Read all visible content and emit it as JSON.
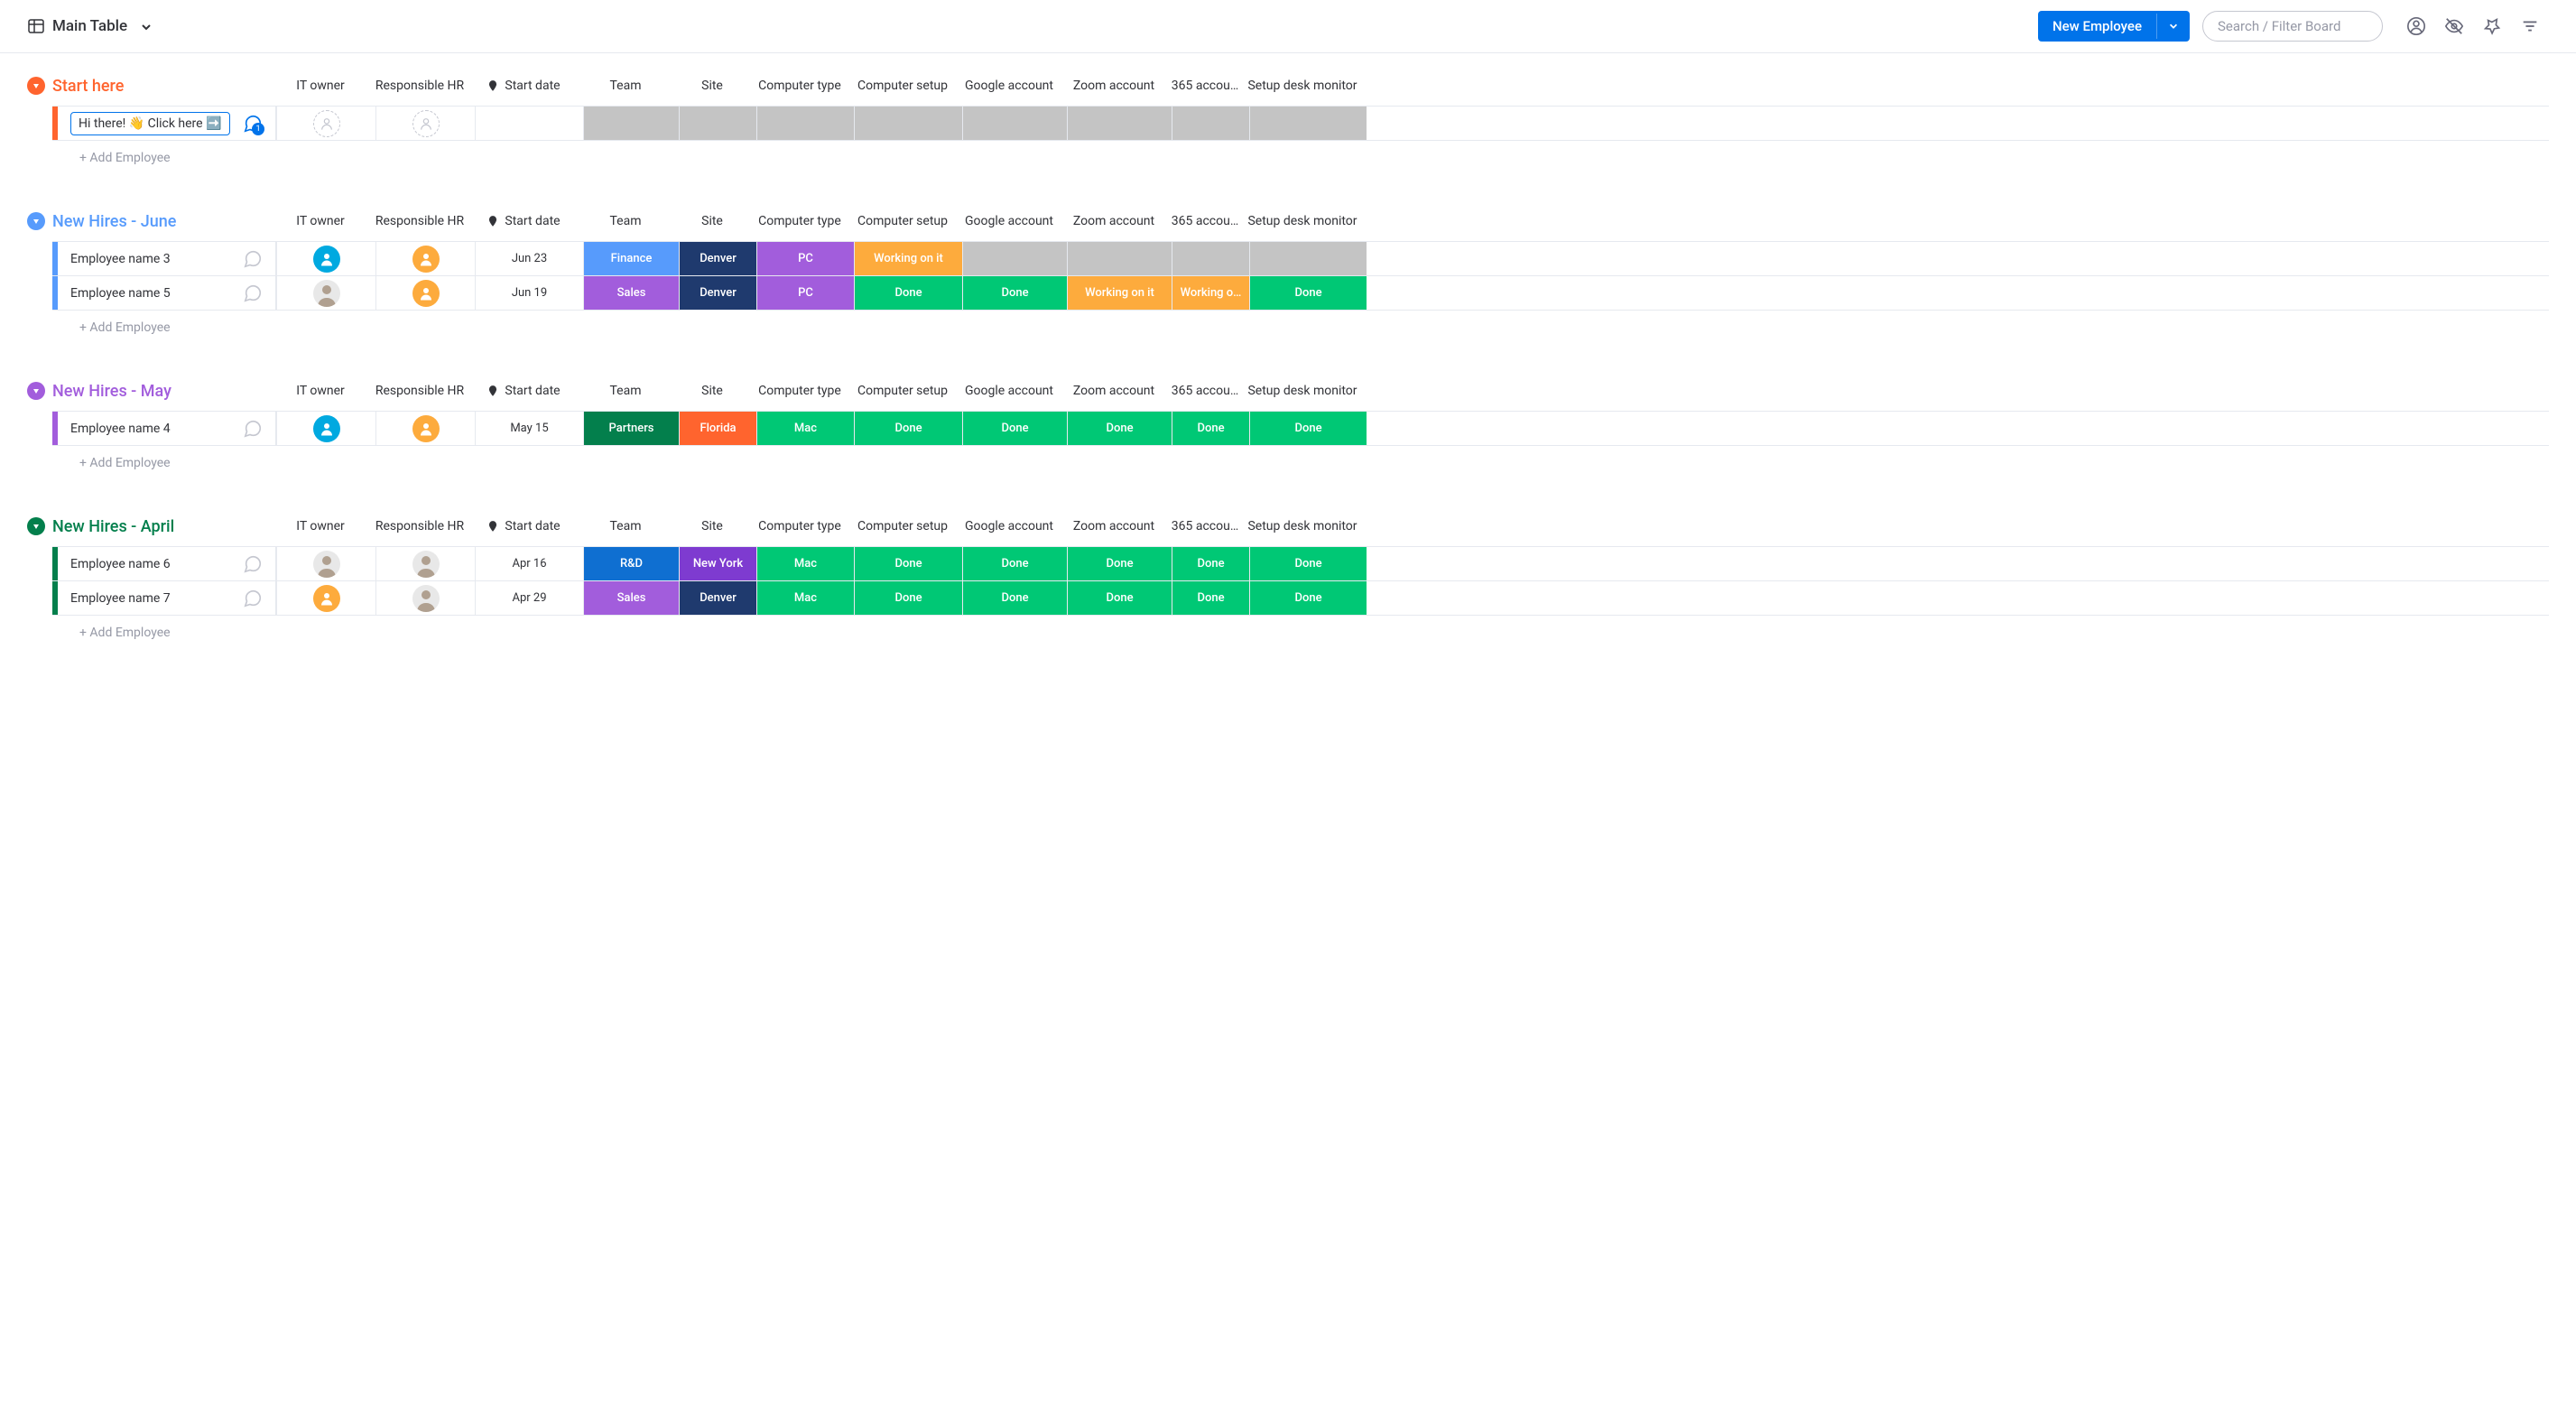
{
  "header": {
    "view_name": "Main Table",
    "new_button": "New Employee",
    "search_placeholder": "Search / Filter Board"
  },
  "columns": {
    "it_owner": "IT owner",
    "hr": "Responsible HR",
    "start_date": "Start date",
    "team": "Team",
    "site": "Site",
    "computer_type": "Computer type",
    "computer_setup": "Computer setup",
    "google": "Google account",
    "zoom": "Zoom account",
    "o365": "365 accou…",
    "monitor": "Setup desk monitor"
  },
  "colors": {
    "start_here": "#ff642e",
    "june": "#579bfc",
    "may": "#a25ddc",
    "april": "#037f4c",
    "finance": "#579bfc",
    "sales": "#a25ddc",
    "partners": "#037f4c",
    "rd": "#0f6fd1",
    "denver": "#1f3a6e",
    "florida": "#ff642e",
    "newyork": "#7e3bd0",
    "pc": "#a25ddc",
    "mac": "#00c875",
    "done": "#00c875",
    "working": "#fdab3d",
    "gray": "#c4c4c4",
    "avatar_blue": "#00a9e0",
    "avatar_yellow": "#fdab3d"
  },
  "groups": [
    {
      "id": "start_here",
      "title": "Start here",
      "color_key": "start_here",
      "rows": [
        {
          "name": "Hi there! 👋  Click here ➡️",
          "highlight": true,
          "chat_badge": "1",
          "it_owner_empty": true,
          "hr_empty": true,
          "gray_cells": true
        }
      ]
    },
    {
      "id": "june",
      "title": "New Hires - June",
      "color_key": "june",
      "rows": [
        {
          "name": "Employee name 3",
          "it_avatar": "avatar_blue",
          "hr_avatar": "avatar_yellow",
          "date": "Jun 23",
          "team": "Finance",
          "team_color": "finance",
          "site": "Denver",
          "site_color": "denver",
          "computer": "PC",
          "computer_color": "pc",
          "setup": "Working on it",
          "setup_color": "working",
          "google": "",
          "google_color": "gray",
          "zoom": "",
          "zoom_color": "gray",
          "o365": "",
          "o365_color": "gray",
          "monitor": "",
          "monitor_color": "gray"
        },
        {
          "name": "Employee name 5",
          "it_avatar": "avatar_blue",
          "it_photo": true,
          "hr_avatar": "avatar_yellow",
          "date": "Jun 19",
          "team": "Sales",
          "team_color": "sales",
          "site": "Denver",
          "site_color": "denver",
          "computer": "PC",
          "computer_color": "pc",
          "setup": "Done",
          "setup_color": "done",
          "google": "Done",
          "google_color": "done",
          "zoom": "Working on it",
          "zoom_color": "working",
          "o365": "Working o…",
          "o365_color": "working",
          "monitor": "Done",
          "monitor_color": "done"
        }
      ]
    },
    {
      "id": "may",
      "title": "New Hires - May",
      "color_key": "may",
      "rows": [
        {
          "name": "Employee name 4",
          "it_avatar": "avatar_blue",
          "hr_avatar": "avatar_yellow",
          "date": "May 15",
          "team": "Partners",
          "team_color": "partners",
          "site": "Florida",
          "site_color": "florida",
          "computer": "Mac",
          "computer_color": "mac",
          "setup": "Done",
          "setup_color": "done",
          "google": "Done",
          "google_color": "done",
          "zoom": "Done",
          "zoom_color": "done",
          "o365": "Done",
          "o365_color": "done",
          "monitor": "Done",
          "monitor_color": "done"
        }
      ]
    },
    {
      "id": "april",
      "title": "New Hires - April",
      "color_key": "april",
      "rows": [
        {
          "name": "Employee name 6",
          "it_avatar": "none",
          "hr_avatar": "none",
          "date": "Apr 16",
          "team": "R&D",
          "team_color": "rd",
          "site": "New York",
          "site_color": "newyork",
          "computer": "Mac",
          "computer_color": "mac",
          "setup": "Done",
          "setup_color": "done",
          "google": "Done",
          "google_color": "done",
          "zoom": "Done",
          "zoom_color": "done",
          "o365": "Done",
          "o365_color": "done",
          "monitor": "Done",
          "monitor_color": "done"
        },
        {
          "name": "Employee name 7",
          "it_avatar": "avatar_yellow",
          "hr_avatar": "none",
          "date": "Apr 29",
          "team": "Sales",
          "team_color": "sales",
          "site": "Denver",
          "site_color": "denver",
          "computer": "Mac",
          "computer_color": "mac",
          "setup": "Done",
          "setup_color": "done",
          "google": "Done",
          "google_color": "done",
          "zoom": "Done",
          "zoom_color": "done",
          "o365": "Done",
          "o365_color": "done",
          "monitor": "Done",
          "monitor_color": "done"
        }
      ]
    }
  ],
  "add_employee_label": "+ Add Employee"
}
